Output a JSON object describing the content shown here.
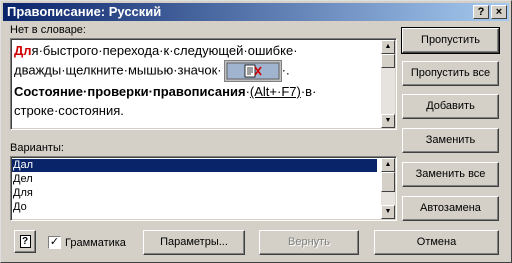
{
  "window": {
    "title": "Правописание: Русский",
    "help_glyph": "?",
    "close_glyph": "×"
  },
  "labels": {
    "not_in_dictionary": "Нет в словаре:",
    "suggestions": "Варианты:"
  },
  "sentence": {
    "error_word": "Дл",
    "part1": "я·быстрого·перехода·к·следующей·ошибке·",
    "part2": "дважды·щелкните·мышью·значок·",
    "part3": "·.",
    "bold_part": "Состояние·проверки·правописания",
    "shortcut_pre": "·",
    "shortcut": "(Alt+·F7)",
    "part4": "·в·",
    "part5": "строке·состояния."
  },
  "suggestions": [
    "Дал",
    "Дел",
    "Для",
    "До"
  ],
  "buttons": {
    "skip": "Пропустить",
    "skip_all": "Пропустить все",
    "add": "Добавить",
    "replace": "Заменить",
    "replace_all": "Заменить все",
    "autocorrect": "Автозамена",
    "options": "Параметры...",
    "undo": "Вернуть",
    "cancel": "Отмена",
    "help_glyph": "?"
  },
  "grammar": {
    "label": "Грамматика",
    "checked": true,
    "mark": "✓"
  },
  "icons": [
    "spellcheck-status-icon",
    "help-icon",
    "close-icon",
    "scroll-up-icon",
    "scroll-down-icon"
  ]
}
